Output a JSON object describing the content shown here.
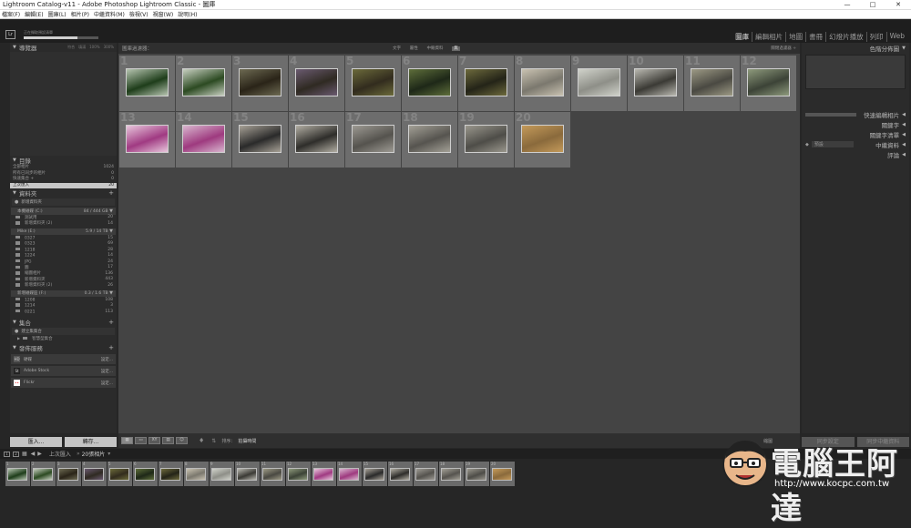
{
  "window": {
    "title": "Lightroom Catalog-v11 - Adobe Photoshop Lightroom Classic - 圖庫",
    "controls": [
      "—",
      "□",
      "✕"
    ]
  },
  "menu": [
    "檔案(F)",
    "編輯(E)",
    "圖庫(L)",
    "相片(P)",
    "中繼資料(M)",
    "檢視(V)",
    "視窗(W)",
    "說明(H)"
  ],
  "identity": {
    "logo": "Lr",
    "sync_status": "正在擷取預設清單",
    "sync_progress": 0.72,
    "modules": [
      {
        "label": "圖庫",
        "active": true
      },
      {
        "label": "編輯相片",
        "active": false
      },
      {
        "label": "地圖",
        "active": false
      },
      {
        "label": "書冊",
        "active": false
      },
      {
        "label": "幻燈片播放",
        "active": false
      },
      {
        "label": "列印",
        "active": false
      },
      {
        "label": "Web",
        "active": false
      }
    ]
  },
  "left": {
    "navigator": {
      "title": "導覽器",
      "zoom": [
        "符合",
        "填滿",
        "100%",
        "300%"
      ]
    },
    "catalog": {
      "title": "目錄",
      "items": [
        {
          "label": "全部相片",
          "count": "1024",
          "selected": false
        },
        {
          "label": "所有已同步的相片",
          "count": "0",
          "selected": false
        },
        {
          "label": "快速集合 +",
          "count": "0",
          "selected": false
        },
        {
          "label": "上次匯入",
          "count": "20",
          "selected": true
        }
      ]
    },
    "folders": {
      "title": "資料夾",
      "add_label": "新增資料夾",
      "volumes": [
        {
          "label": "本機磁碟 (C:)",
          "size": "84 / 444 GB",
          "folders": [
            {
              "label": "測試用",
              "count": "20"
            },
            {
              "label": "新增資料夾 (2)",
              "count": "14"
            }
          ]
        },
        {
          "label": "Mike (E:)",
          "size": "5.9 / 14 TB",
          "folders": [
            {
              "label": "0327",
              "count": "15"
            },
            {
              "label": "0323",
              "count": "69"
            },
            {
              "label": "1218",
              "count": "28"
            },
            {
              "label": "1224",
              "count": "14"
            },
            {
              "label": "JPG",
              "count": "24"
            },
            {
              "label": "圖",
              "count": "17"
            },
            {
              "label": "縮圖相片",
              "count": "136"
            },
            {
              "label": "新增資料夾",
              "count": "443"
            },
            {
              "label": "新增資料夾 (2)",
              "count": "26"
            }
          ]
        },
        {
          "label": "新增磁碟區 (F:)",
          "size": "0.3 / 1.6 TB",
          "folders": [
            {
              "label": "1208",
              "count": "108"
            },
            {
              "label": "1214",
              "count": "3"
            },
            {
              "label": "0221",
              "count": "113"
            }
          ]
        }
      ]
    },
    "collections": {
      "title": "集合",
      "add_label": "建立集集合",
      "items": [
        {
          "label": "智慧型集合"
        }
      ]
    },
    "publish": {
      "title": "發佈服務",
      "items": [
        {
          "label": "硬碟",
          "action": "設定...",
          "badge": "HD"
        },
        {
          "label": "Adobe Stock",
          "action": "設定...",
          "badge": "St"
        },
        {
          "label": "Flickr",
          "action": "設定...",
          "badge": "••"
        }
      ]
    },
    "buttons": {
      "import": "匯入...",
      "export": "轉存..."
    }
  },
  "center": {
    "filter": {
      "title": "圖庫過濾器：",
      "options": [
        "文字",
        "屬性",
        "中繼資料",
        "無"
      ],
      "preset": "關閉過濾器 ÷"
    },
    "photos": [
      {
        "n": "1",
        "c1": "#1e3d1a",
        "c2": "#b6c4b0"
      },
      {
        "n": "2",
        "c1": "#2c4a22",
        "c2": "#c7cfc0"
      },
      {
        "n": "3",
        "c1": "#2a2418",
        "c2": "#6d6a52"
      },
      {
        "n": "4",
        "c1": "#2f2a22",
        "c2": "#6a5a70"
      },
      {
        "n": "5",
        "c1": "#322c1e",
        "c2": "#6b6a3a"
      },
      {
        "n": "6",
        "c1": "#1e2818",
        "c2": "#5e6e3a"
      },
      {
        "n": "7",
        "c1": "#242418",
        "c2": "#6d6a3c"
      },
      {
        "n": "8",
        "c1": "#7b786e",
        "c2": "#c9c2b1"
      },
      {
        "n": "9",
        "c1": "#8e8f88",
        "c2": "#d0d2ca"
      },
      {
        "n": "10",
        "c1": "#3b3a35",
        "c2": "#b9b8b0"
      },
      {
        "n": "11",
        "c1": "#4a4942",
        "c2": "#9d9a85"
      },
      {
        "n": "12",
        "c1": "#3c4337",
        "c2": "#8e9a7c"
      },
      {
        "n": "13",
        "c1": "#a03a82",
        "c2": "#e8c6dc"
      },
      {
        "n": "14",
        "c1": "#9e3a7f",
        "c2": "#d9b6cf"
      },
      {
        "n": "15",
        "c1": "#2a2a2a",
        "c2": "#a7a196"
      },
      {
        "n": "16",
        "c1": "#2e2d2a",
        "c2": "#b2aea3"
      },
      {
        "n": "17",
        "c1": "#55534e",
        "c2": "#9d9a93"
      },
      {
        "n": "18",
        "c1": "#56544f",
        "c2": "#a3a096"
      },
      {
        "n": "19",
        "c1": "#4e4d48",
        "c2": "#9a978d"
      },
      {
        "n": "20",
        "c1": "#8a6a3c",
        "c2": "#c49a5a"
      }
    ],
    "toolbar": {
      "sort_label": "排序：",
      "sort_value": "拍攝時間",
      "thumbs_label": "縮圖"
    }
  },
  "right": {
    "histogram": "色階分佈圖",
    "quick_develop": "快速編輯相片",
    "keywording": "關鍵字",
    "keyword_list": "關鍵字清單",
    "metadata": {
      "title": "中繼資料",
      "preset": "預設"
    },
    "comments": "評論",
    "buttons": {
      "sync": "同步設定",
      "sync_meta": "同步中繼資料"
    }
  },
  "filmstrip": {
    "source_prefix": "上次匯入",
    "count_label": "20張相片"
  },
  "watermark": {
    "text": "電腦王阿達",
    "url": "http://www.kocpc.com.tw"
  }
}
